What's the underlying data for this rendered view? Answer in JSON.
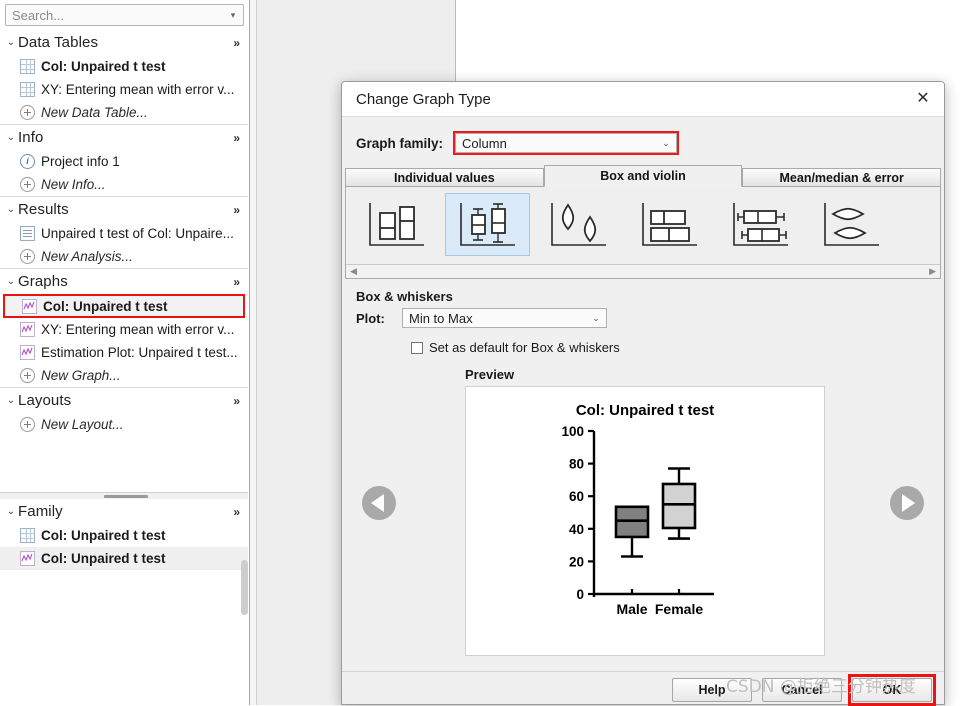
{
  "navigator": {
    "search": {
      "placeholder": "Search...",
      "value": ""
    },
    "sections": [
      {
        "title": "Data Tables",
        "expand": "»",
        "items": [
          {
            "label": "Col: Unpaired t test",
            "icon": "table-icon",
            "style": "bold"
          },
          {
            "label": "XY: Entering mean with error v...",
            "icon": "table-icon",
            "style": "normal"
          },
          {
            "label": "New Data Table...",
            "icon": "plus-circle-icon",
            "style": "italic"
          }
        ]
      },
      {
        "title": "Info",
        "expand": "»",
        "items": [
          {
            "label": "Project info 1",
            "icon": "info-icon",
            "style": "normal"
          },
          {
            "label": "New Info...",
            "icon": "plus-circle-icon",
            "style": "italic"
          }
        ]
      },
      {
        "title": "Results",
        "expand": "»",
        "items": [
          {
            "label": "Unpaired t test of Col: Unpaire...",
            "icon": "results-icon",
            "style": "normal"
          },
          {
            "label": "New Analysis...",
            "icon": "plus-circle-icon",
            "style": "italic"
          }
        ]
      },
      {
        "title": "Graphs",
        "expand": "»",
        "items": [
          {
            "label": "Col: Unpaired t test",
            "icon": "graph-icon",
            "style": "bold",
            "selected": true
          },
          {
            "label": "XY: Entering mean with error v...",
            "icon": "graph-icon",
            "style": "normal"
          },
          {
            "label": "Estimation Plot: Unpaired t test...",
            "icon": "graph-icon",
            "style": "normal"
          },
          {
            "label": "New Graph...",
            "icon": "plus-circle-icon",
            "style": "italic"
          }
        ]
      },
      {
        "title": "Layouts",
        "expand": "»",
        "items": [
          {
            "label": "New Layout...",
            "icon": "plus-circle-icon",
            "style": "italic"
          }
        ]
      }
    ],
    "family": {
      "title": "Family",
      "expand": "»",
      "items": [
        {
          "label": "Col: Unpaired t test",
          "icon": "table-icon",
          "style": "bold"
        },
        {
          "label": "Col: Unpaired t test",
          "icon": "graph-icon",
          "style": "bold",
          "highlight": true
        }
      ]
    }
  },
  "dialog": {
    "title": "Change Graph Type",
    "close_label": "✕",
    "graph_family": {
      "label": "Graph family:",
      "value": "Column",
      "caret": "⌄"
    },
    "tabs": [
      {
        "label": "Individual values",
        "active": false
      },
      {
        "label": "Box and violin",
        "active": true
      },
      {
        "label": "Mean/median & error",
        "active": false
      }
    ],
    "gallery": {
      "thumbs": [
        {
          "name": "floating-bars-thumb",
          "selected": false
        },
        {
          "name": "box-whiskers-vertical-thumb",
          "selected": true
        },
        {
          "name": "violin-plot-thumb",
          "selected": false
        },
        {
          "name": "floating-bars-horizontal-thumb",
          "selected": false
        },
        {
          "name": "box-whiskers-horizontal-thumb",
          "selected": false
        },
        {
          "name": "violin-plot-horizontal-thumb",
          "selected": false
        }
      ],
      "scroll_left": "◀",
      "scroll_right": "▶"
    },
    "options": {
      "section_label": "Box & whiskers",
      "plot_label": "Plot:",
      "plot_value": "Min to Max",
      "plot_caret": "⌄",
      "default_checkbox_label": "Set as default for Box & whiskers",
      "default_checkbox_checked": false
    },
    "preview_label": "Preview",
    "prev_arrow": "previous-graph-type",
    "next_arrow": "next-graph-type",
    "buttons": {
      "help": "Help",
      "cancel": "Cancel",
      "ok": "OK"
    }
  },
  "watermark": "CSDN @拒绝三分钟热度",
  "chart_data": {
    "type": "box",
    "title": "Col: Unpaired t test",
    "categories": [
      "Male",
      "Female"
    ],
    "xlabel": "",
    "ylabel": "",
    "ylim": [
      0,
      100
    ],
    "yticks": [
      0,
      20,
      40,
      60,
      80,
      100
    ],
    "grid": false,
    "whisker_style": "Min to Max",
    "series": [
      {
        "name": "Male",
        "fill": "#808080",
        "min": 23,
        "q1": 35,
        "median": 45,
        "q3": 53.5,
        "max": 53.5
      },
      {
        "name": "Female",
        "fill": "#d2d2d2",
        "min": 34,
        "q1": 40.5,
        "median": 55,
        "q3": 67.5,
        "max": 77
      }
    ]
  }
}
